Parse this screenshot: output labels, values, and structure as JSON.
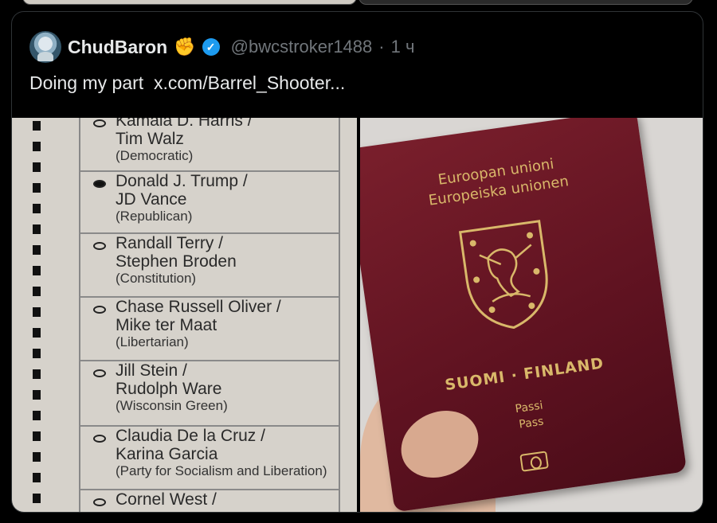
{
  "tweet": {
    "display_name": "ChudBaron",
    "handle": "@bwcstroker1488",
    "separator": "·",
    "time": "1 ч",
    "text": "Doing my part  x.com/Barrel_Shooter..."
  },
  "ballot": {
    "candidates": [
      {
        "line1": "Kamala D. Harris /",
        "line2": "Tim Walz",
        "party": "(Democratic)",
        "marked": false
      },
      {
        "line1": "Donald J. Trump /",
        "line2": "JD Vance",
        "party": "(Republican)",
        "marked": true
      },
      {
        "line1": "Randall Terry /",
        "line2": "Stephen Broden",
        "party": "(Constitution)",
        "marked": false
      },
      {
        "line1": "Chase Russell Oliver /",
        "line2": "Mike ter Maat",
        "party": "(Libertarian)",
        "marked": false
      },
      {
        "line1": "Jill Stein /",
        "line2": "Rudolph Ware",
        "party": "(Wisconsin Green)",
        "marked": false
      },
      {
        "line1": "Claudia De la Cruz /",
        "line2": "Karina Garcia",
        "party": "(Party for Socialism and Liberation)",
        "marked": false
      },
      {
        "line1": "Cornel West /",
        "line2": "",
        "party": "",
        "marked": false
      }
    ]
  },
  "passport": {
    "line1": "Euroopan unioni",
    "line2": "Europeiska unionen",
    "country": "SUOMI · FINLAND",
    "type1": "Passi",
    "type2": "Pass",
    "color": "#6a1726",
    "foil_color": "#d9b86a"
  },
  "icons": {
    "verified": "verified-badge-icon",
    "emoji": "raised-fist-emoji"
  }
}
